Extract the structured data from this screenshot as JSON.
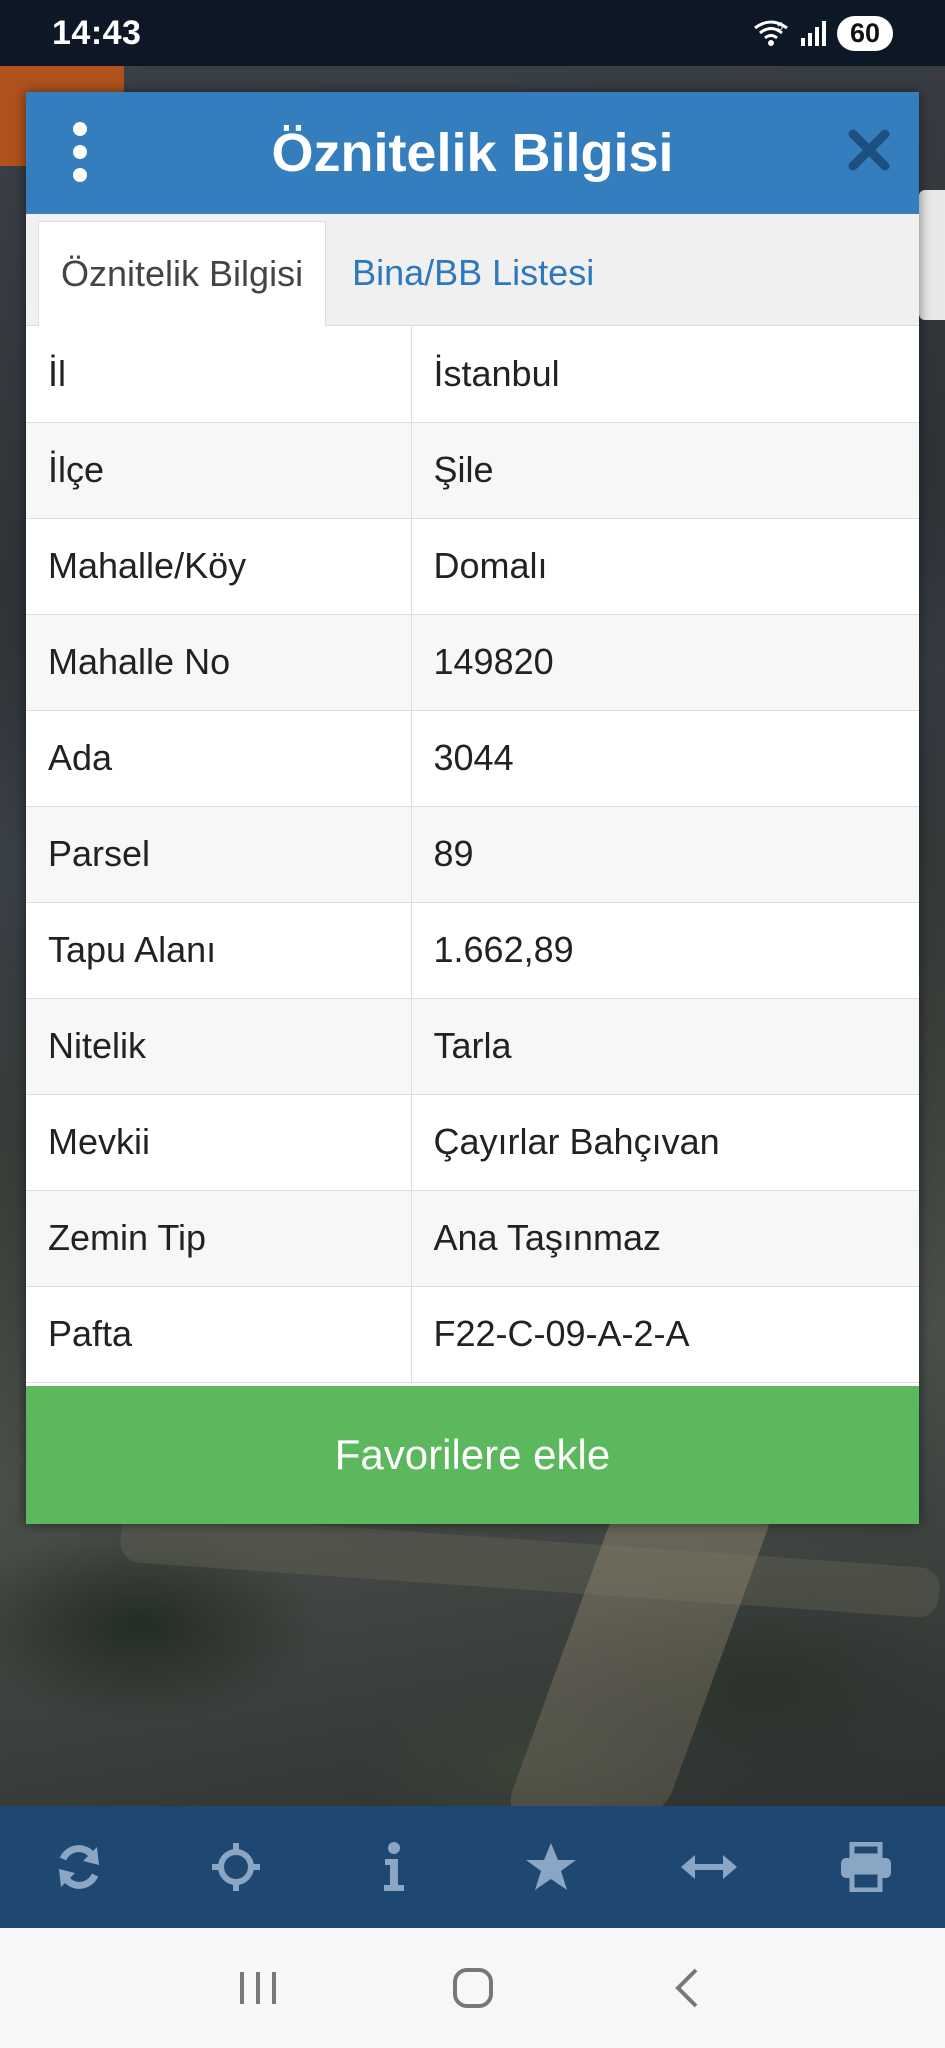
{
  "status_bar": {
    "time": "14:43",
    "wifi_badge": "5",
    "battery": "60"
  },
  "dialog": {
    "title": "Öznitelik Bilgisi",
    "tabs": [
      {
        "label": "Öznitelik Bilgisi",
        "active": true
      },
      {
        "label": "Bina/BB Listesi",
        "active": false
      }
    ],
    "rows": [
      {
        "key": "İl",
        "value": "İstanbul"
      },
      {
        "key": "İlçe",
        "value": "Şile"
      },
      {
        "key": "Mahalle/Köy",
        "value": "Domalı"
      },
      {
        "key": "Mahalle No",
        "value": "149820"
      },
      {
        "key": "Ada",
        "value": "3044"
      },
      {
        "key": "Parsel",
        "value": "89"
      },
      {
        "key": "Tapu Alanı",
        "value": "1.662,89"
      },
      {
        "key": "Nitelik",
        "value": "Tarla"
      },
      {
        "key": "Mevkii",
        "value": "Çayırlar Bahçıvan"
      },
      {
        "key": "Zemin Tip",
        "value": "Ana Taşınmaz"
      },
      {
        "key": "Pafta",
        "value": "F22-C-09-A-2-A"
      }
    ],
    "favorite_button": "Favorilere ekle"
  },
  "toolbar": {
    "icons": [
      "refresh-icon",
      "crosshair-icon",
      "info-icon",
      "star-icon",
      "measure-icon",
      "print-icon"
    ]
  },
  "navbar": {
    "icons": [
      "recent-apps-icon",
      "home-icon",
      "back-icon"
    ]
  },
  "colors": {
    "header_blue": "#357ebd",
    "tab_link_blue": "#2e78c0",
    "favorite_green": "#5cb85c",
    "toolbar_navy": "#1e4872",
    "status_bar": "#0c1826",
    "map_accent_orange": "#b0521d"
  }
}
